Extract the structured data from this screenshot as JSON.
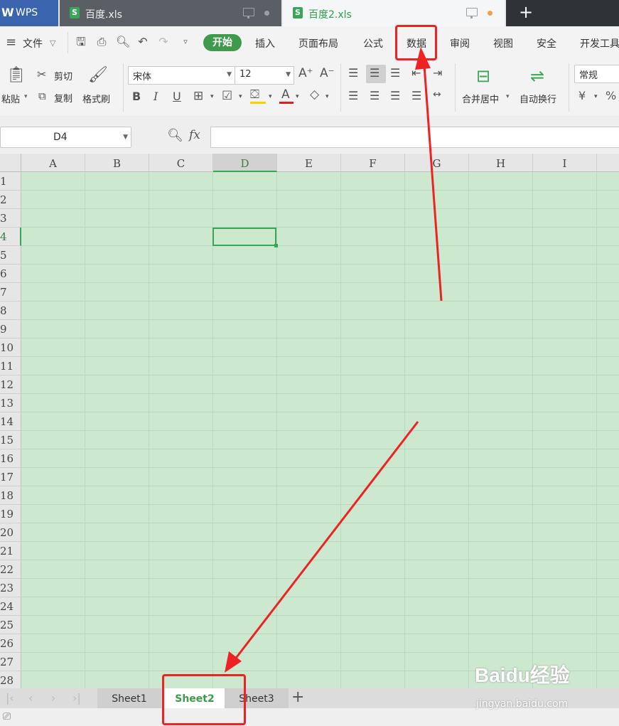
{
  "titlebar": {
    "app_tab": "WPS",
    "doc_tabs": [
      {
        "name": "百度.xls"
      },
      {
        "name": "百度2.xls"
      }
    ],
    "new_tab": "+"
  },
  "menubar": {
    "file": "文件",
    "items": [
      "开始",
      "插入",
      "页面布局",
      "公式",
      "数据",
      "审阅",
      "视图",
      "安全",
      "开发工具"
    ]
  },
  "ribbon": {
    "paste": "粘贴",
    "cut": "剪切",
    "copy": "复制",
    "format_painter": "格式刷",
    "font_name": "宋体",
    "font_size": "12",
    "merge_center": "合并居中",
    "wrap_text": "自动换行",
    "number_format": "常规"
  },
  "formula_bar": {
    "name_box": "D4",
    "fx": "fx",
    "content": ""
  },
  "grid": {
    "columns": [
      "A",
      "B",
      "C",
      "D",
      "E",
      "F",
      "G",
      "H",
      "I"
    ],
    "rows": [
      "1",
      "2",
      "3",
      "4",
      "5",
      "6",
      "7",
      "8",
      "9",
      "10",
      "11",
      "12",
      "13",
      "14",
      "15",
      "16",
      "17",
      "18",
      "19",
      "20",
      "21",
      "22",
      "23",
      "24",
      "25",
      "26",
      "27",
      "28"
    ],
    "selected_cell": "D4",
    "background": "#cce8cf"
  },
  "sheets": {
    "tabs": [
      "Sheet1",
      "Sheet2",
      "Sheet3"
    ],
    "active": "Sheet2",
    "add": "+"
  },
  "watermark": {
    "brand": "Baidu经验",
    "url": "jingyan.baidu.com"
  },
  "colors": {
    "accent_green": "#3aa556",
    "annotation_red": "#ee2222"
  }
}
